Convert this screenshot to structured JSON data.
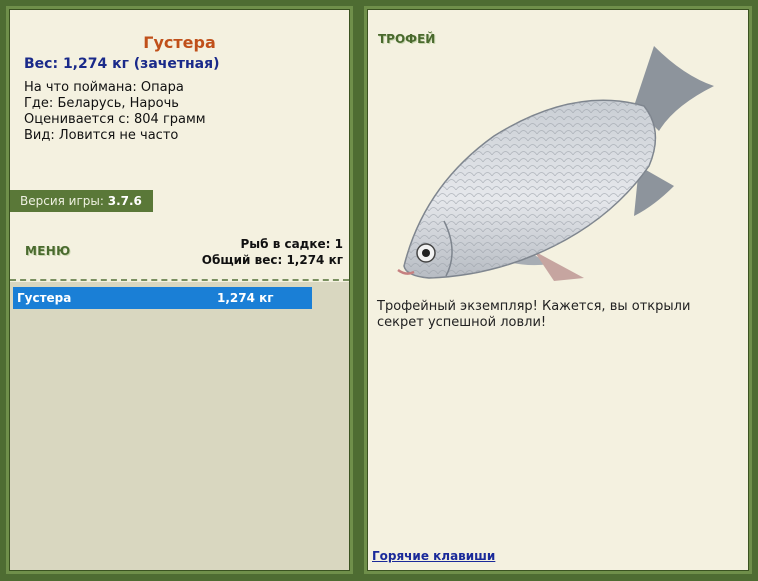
{
  "fish": {
    "name": "Густера",
    "weight_line": "Вес: 1,274 кг (зачетная)",
    "info": [
      {
        "label": "На что поймана:",
        "value": "Опара"
      },
      {
        "label": "Где:",
        "value": "Беларусь, Нарочь"
      },
      {
        "label": "Оценивается с:",
        "value": "804 грамм"
      },
      {
        "label": "Вид:",
        "value": "Ловится не часто"
      }
    ]
  },
  "version": {
    "label": "Версия игры:",
    "value": "3.7.6"
  },
  "menu_label": "МЕНЮ",
  "stats": {
    "fish_in_keepnet": "Рыб в садке: 1",
    "total_weight": "Общий вес: 1,274 кг"
  },
  "catch_list": [
    {
      "name": "Густера",
      "weight": "1,274 кг"
    }
  ],
  "trophy": {
    "label": "ТРОФЕЙ",
    "description": "Трофейный экземпляр! Кажется, вы открыли секрет успешной ловли!"
  },
  "hotkeys_label": "Горячие клавиши",
  "colors": {
    "frame": "#4e6c32",
    "panel": "#f4f1e0",
    "title": "#c0501a",
    "weight": "#1a2a8a",
    "selection": "#1a7fd6",
    "link": "#1a2a9a"
  }
}
